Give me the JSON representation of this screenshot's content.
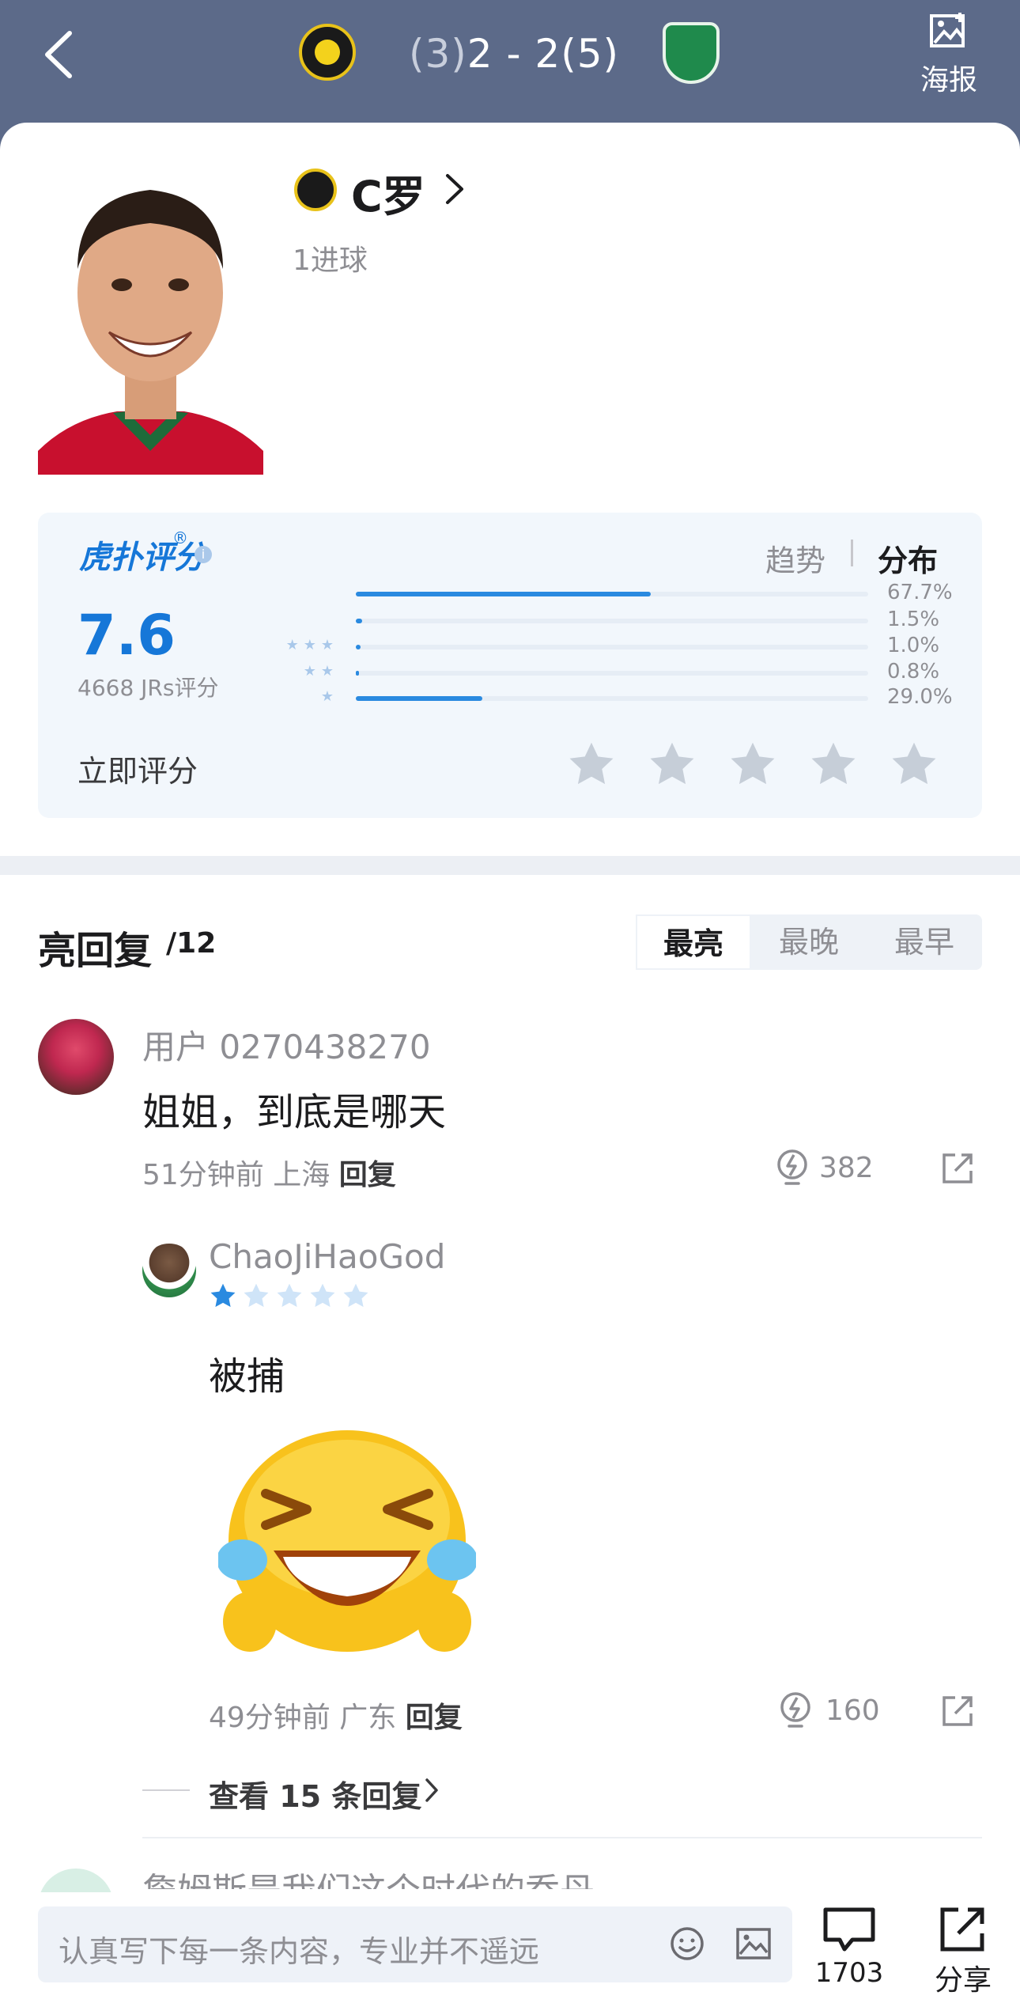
{
  "header": {
    "score_text": "2 - 2",
    "home_pen": "(3)",
    "away_pen": "(5)",
    "poster_label": "海报"
  },
  "player": {
    "name": "C罗",
    "goals": "1进球"
  },
  "rating": {
    "logo": "虎扑评分",
    "reg": "®",
    "tab_trend": "趋势",
    "tab_dist": "分布",
    "score": "7.6",
    "count": "4668 JRs评分",
    "rate_now": "立即评分",
    "distribution": [
      {
        "stars": "",
        "pct_label": "67.7%",
        "value": 67.7
      },
      {
        "stars": "",
        "pct_label": "1.5%",
        "value": 1.5
      },
      {
        "stars": "★★★",
        "pct_label": "1.0%",
        "value": 1.0
      },
      {
        "stars": "★★",
        "pct_label": "0.8%",
        "value": 0.8
      },
      {
        "stars": "★",
        "pct_label": "29.0%",
        "value": 29.0
      }
    ]
  },
  "replies": {
    "title": "亮回复",
    "count": "/12",
    "sort": [
      "最亮",
      "最晚",
      "最早"
    ]
  },
  "comment1": {
    "user": "用户 0270438270",
    "text": "姐姐，到底是哪天",
    "meta": "51分钟前 上海 ",
    "reply": "回复",
    "lights": "382"
  },
  "comment2": {
    "user": "ChaoJiHaoGod",
    "rating_stars": 1,
    "text": "被捕",
    "meta": "49分钟前 广东 ",
    "reply": "回复",
    "lights": "160",
    "more": "查看 15 条回复"
  },
  "comment3": {
    "text": "詹姆斯是我们这个时代的乔丹"
  },
  "bottom": {
    "placeholder": "认真写下每一条内容，专业并不遥远",
    "comment_count": "1703",
    "share_label": "分享"
  },
  "colors": {
    "header_bg": "#5c6a89",
    "accent": "#1677d8",
    "star_active": "#2a8ae0"
  }
}
